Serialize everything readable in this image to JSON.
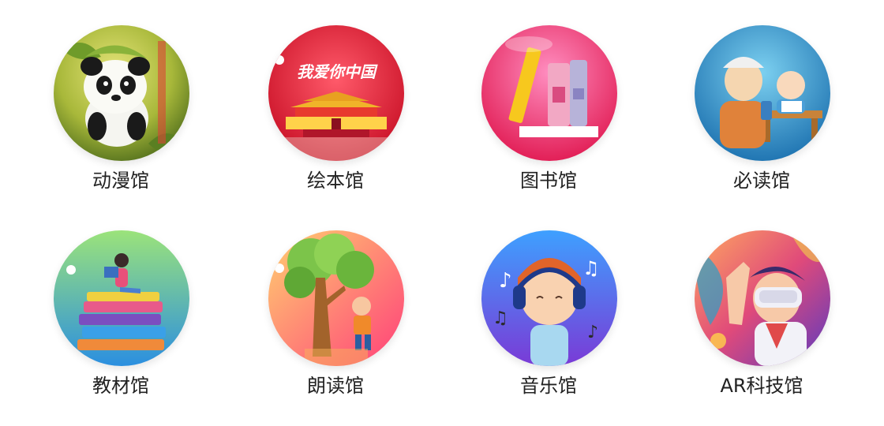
{
  "venues": [
    {
      "label": "动漫馆",
      "icon": "panda-icon",
      "colors": [
        "#c9d24a",
        "#5d7f23"
      ]
    },
    {
      "label": "绘本馆",
      "icon": "tiananmen-icon",
      "colors": [
        "#ff4b5e",
        "#d4142a"
      ],
      "banner_text": "我爱你中国"
    },
    {
      "label": "图书馆",
      "icon": "books-icon",
      "colors": [
        "#ff6aa8",
        "#e0174f"
      ]
    },
    {
      "label": "必读馆",
      "icon": "teacher-child-icon",
      "colors": [
        "#4fb3e0",
        "#1f78b8"
      ]
    },
    {
      "label": "教材馆",
      "icon": "textbook-stack-icon",
      "colors": [
        "#8fe07a",
        "#2f93e0"
      ]
    },
    {
      "label": "朗读馆",
      "icon": "reading-tree-icon",
      "colors": [
        "#ffb347",
        "#ff4f7a"
      ]
    },
    {
      "label": "音乐馆",
      "icon": "music-headphones-icon",
      "colors": [
        "#4aa4ff",
        "#7b3dd6"
      ]
    },
    {
      "label": "AR科技馆",
      "icon": "vr-headset-icon",
      "colors": [
        "#ff9a5c",
        "#7a46c9"
      ]
    }
  ]
}
